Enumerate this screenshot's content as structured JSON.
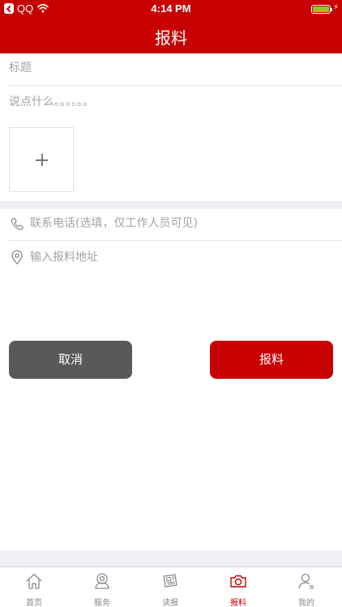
{
  "status_bar": {
    "back_app": "QQ",
    "time": "4:14 PM"
  },
  "nav": {
    "title": "报料"
  },
  "form": {
    "title_placeholder": "标题",
    "content_placeholder": "说点什么。。。。。。",
    "phone_placeholder": "联系电话(选填，仅工作人员可见)",
    "address_placeholder": "输入报料地址"
  },
  "actions": {
    "cancel_label": "取消",
    "submit_label": "报料"
  },
  "tabbar": {
    "items": [
      {
        "label": "首页",
        "icon": "home-icon"
      },
      {
        "label": "服务",
        "icon": "service-icon"
      },
      {
        "label": "读报",
        "icon": "newspaper-icon"
      },
      {
        "label": "报料",
        "icon": "camera-icon"
      },
      {
        "label": "我的",
        "icon": "user-icon"
      }
    ],
    "active_index": 3
  },
  "colors": {
    "brand": "#c70000",
    "cancel": "#595959",
    "battery": "#7ed321"
  }
}
